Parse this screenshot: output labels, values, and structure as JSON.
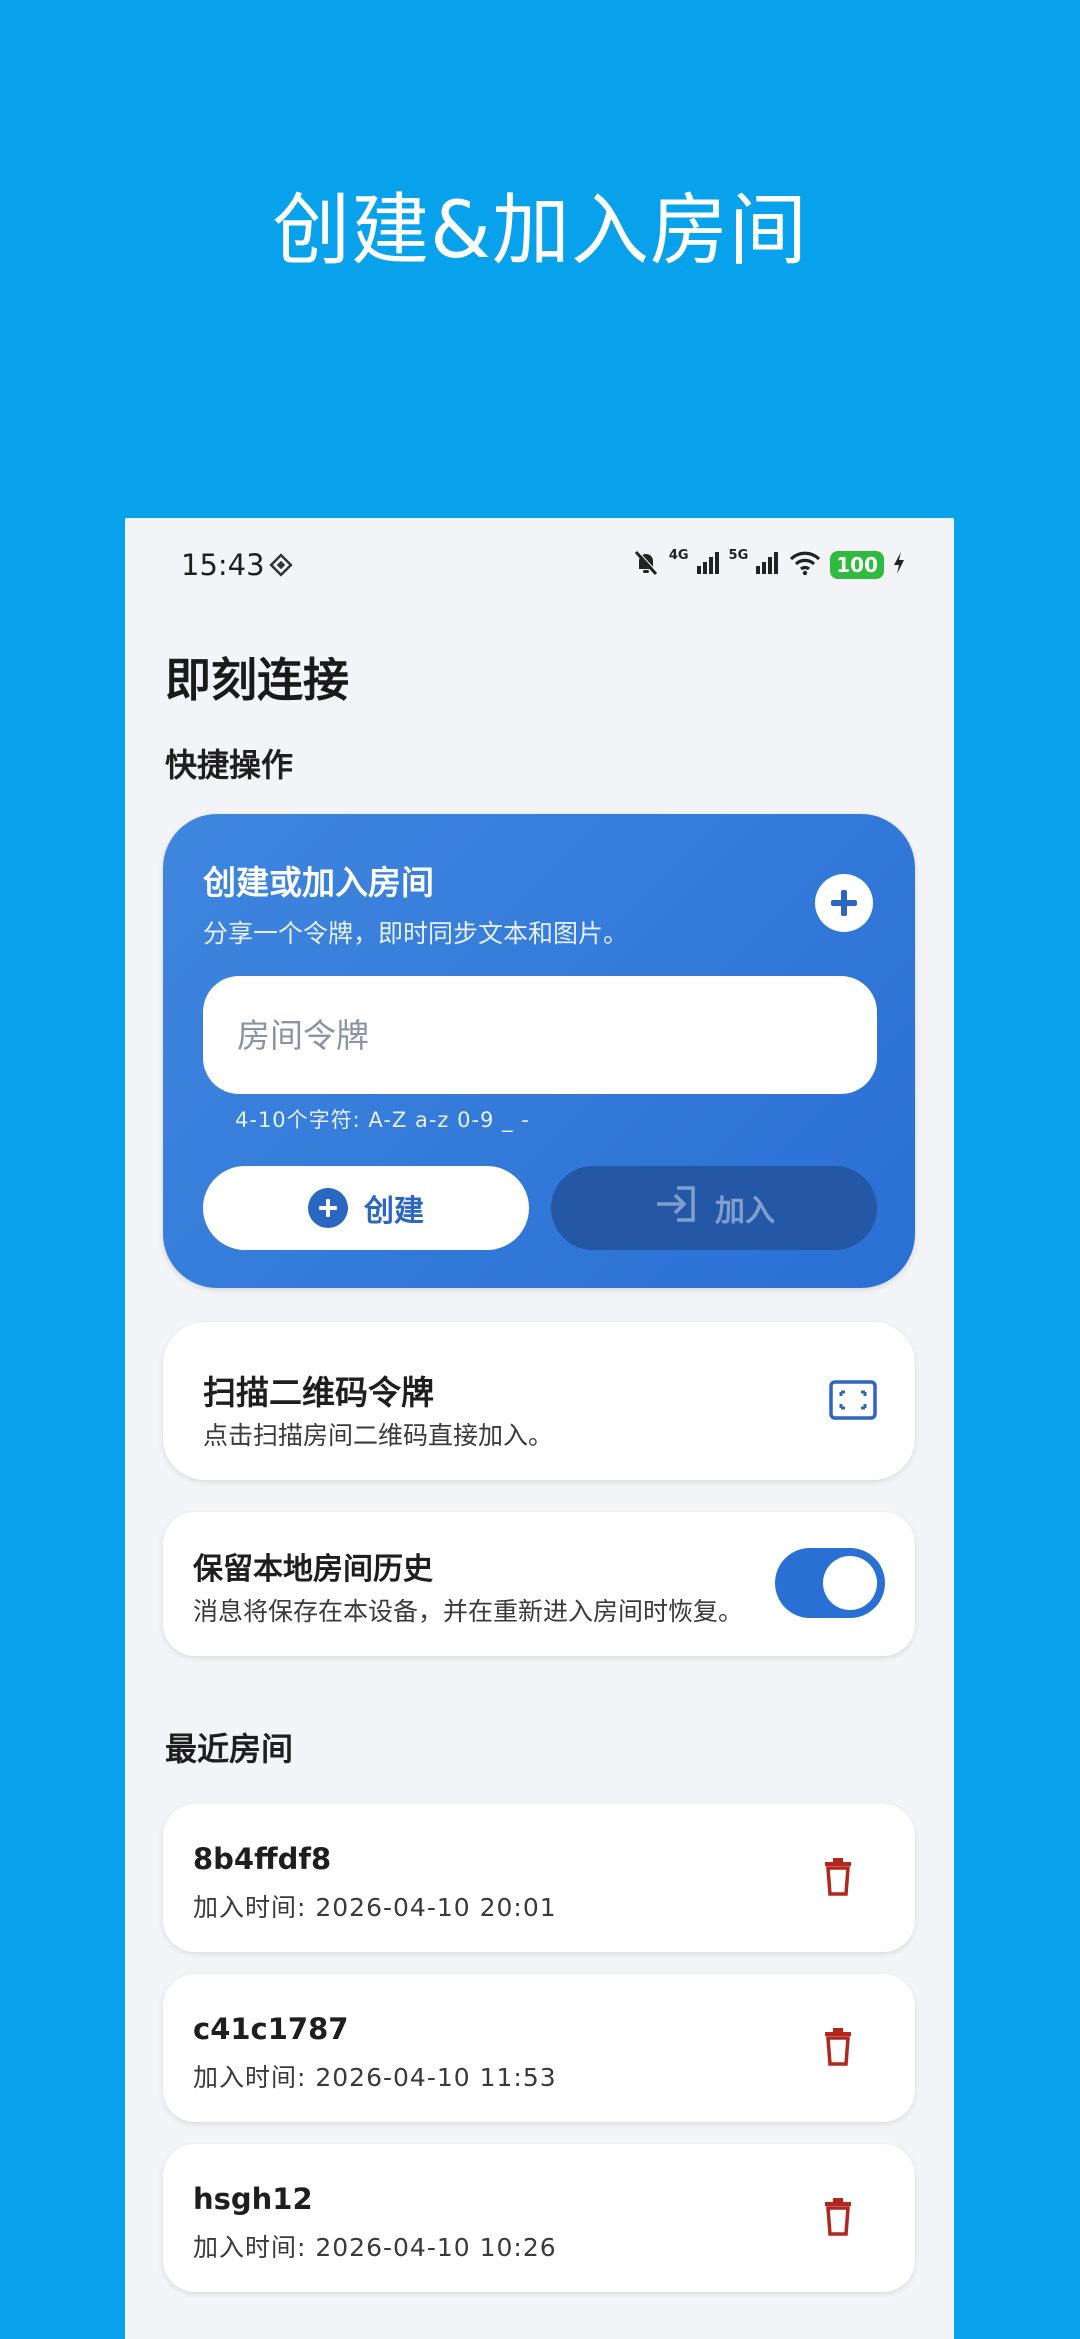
{
  "promo": {
    "title": "创建&加入房间"
  },
  "status_bar": {
    "time": "15:43",
    "net1": "4G",
    "net2": "5G",
    "battery": "100"
  },
  "app": {
    "title": "即刻连接",
    "quick_actions_label": "快捷操作",
    "recent_rooms_label": "最近房间"
  },
  "room_card": {
    "title": "创建或加入房间",
    "description": "分享一个令牌，即时同步文本和图片。",
    "input_placeholder": "房间令牌",
    "input_value": "",
    "hint": "4-10个字符: A-Z a-z 0-9 _ -",
    "create_label": "创建",
    "join_label": "加入"
  },
  "scan_card": {
    "title": "扫描二维码令牌",
    "description": "点击扫描房间二维码直接加入。"
  },
  "history_card": {
    "title": "保留本地房间历史",
    "description": "消息将保存在本设备，并在重新进入房间时恢复。",
    "enabled": true
  },
  "recent_rooms": [
    {
      "name": "8b4ffdf8",
      "joined": "加入时间: 2026-04-10 20:01"
    },
    {
      "name": "c41c1787",
      "joined": "加入时间: 2026-04-10 11:53"
    },
    {
      "name": "hsgh12",
      "joined": "加入时间: 2026-04-10 10:26"
    }
  ],
  "colors": {
    "background": "#08a2ec",
    "primary": "#2a6fd3",
    "danger": "#b3261e"
  }
}
